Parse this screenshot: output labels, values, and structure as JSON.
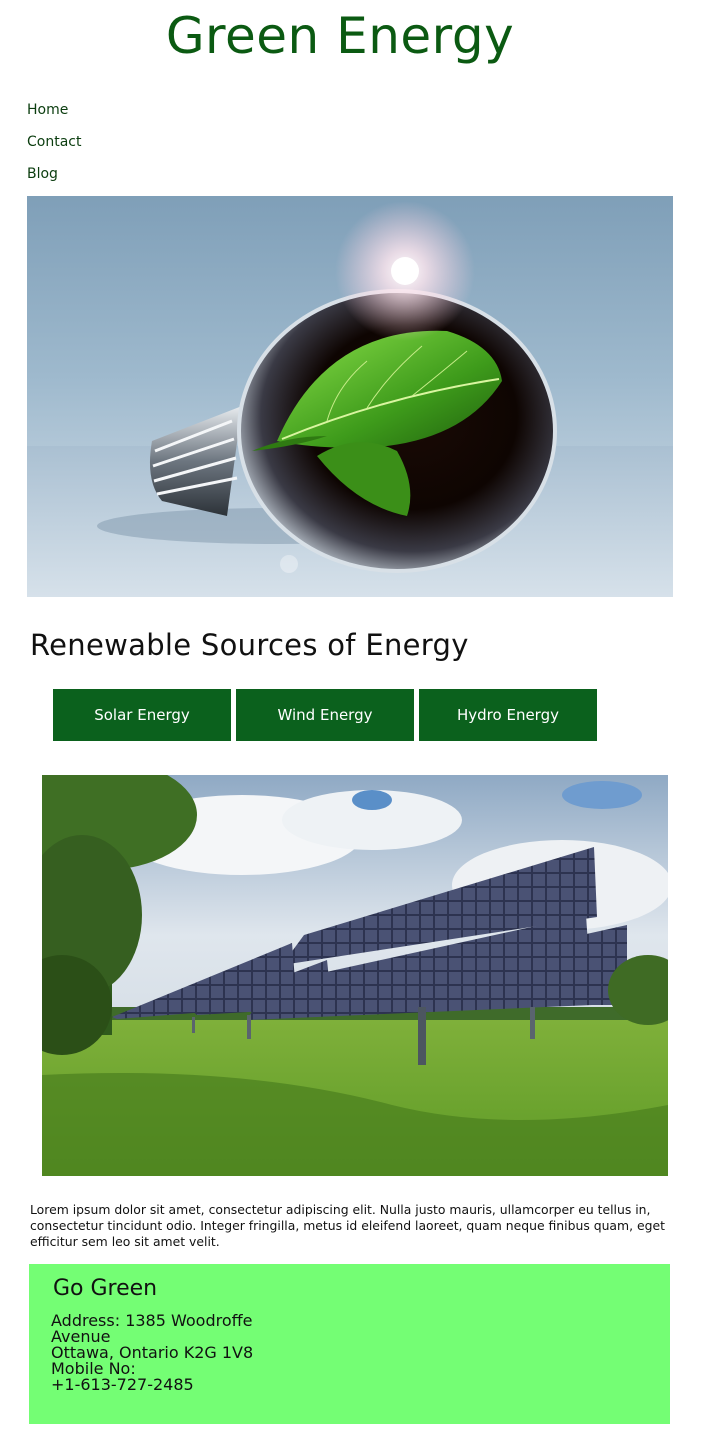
{
  "header": {
    "title": "Green Energy"
  },
  "nav": {
    "items": [
      "Home",
      "Contact",
      "Blog"
    ]
  },
  "hero": {
    "image": "lightbulb-with-leaf"
  },
  "section": {
    "title": "Renewable Sources of Energy",
    "tabs": [
      "Solar Energy",
      "Wind Energy",
      "Hydro Energy"
    ]
  },
  "content": {
    "image": "solar-panels-in-field",
    "text": "Lorem ipsum dolor sit amet, consectetur adipiscing elit. Nulla justo mauris, ullamcorper eu tellus in, consectetur tincidunt odio. Integer fringilla, metus id eleifend laoreet, quam neque finibus quam, eget efficitur sem leo sit amet velit."
  },
  "footer": {
    "title": "Go Green",
    "address_line1": "Address: 1385 Woodroffe",
    "address_line2": "Avenue",
    "address_line3": "Ottawa, Ontario K2G 1V8",
    "mobile_label": "Mobile No:",
    "mobile_number": "+1-613-727-2485"
  },
  "colors": {
    "title": "#0b5a12",
    "tab_bg": "#0b611d",
    "footer_bg": "#74fe74"
  }
}
